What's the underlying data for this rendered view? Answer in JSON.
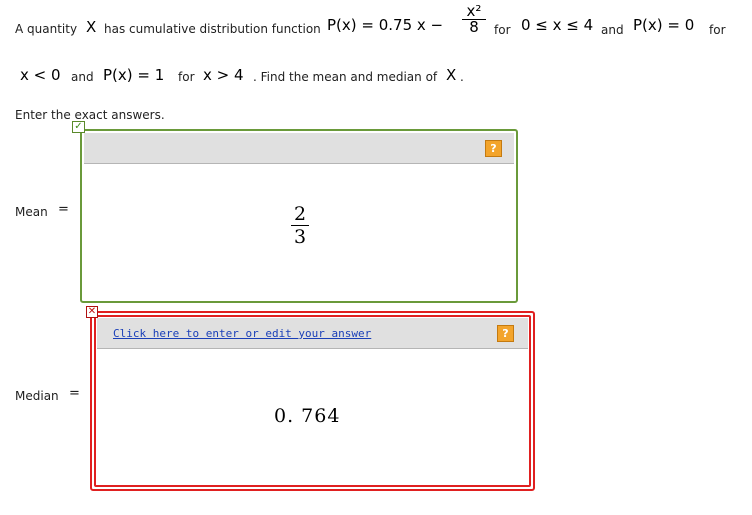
{
  "question": {
    "line1": {
      "t1": "A quantity",
      "var_x": "X",
      "t2": "has cumulative distribution function",
      "expr_lhs": "P(x)  =  0.75 x  −",
      "frac_num": "x²",
      "frac_den": "8",
      "t3": "for",
      "range": "0 ≤ x ≤ 4",
      "t4": "and",
      "expr2": "P(x)  =  0",
      "t5": "for"
    },
    "line2": {
      "cond1": "x < 0",
      "t1": "and",
      "expr": "P(x)  =  1",
      "t2": "for",
      "cond2": "x > 4",
      "t3": ". Find the mean and median of",
      "var_x": "X",
      "period": "."
    },
    "instruction": "Enter the exact answers."
  },
  "answers": {
    "mean": {
      "label": "Mean",
      "equals": "=",
      "num": "2",
      "den": "3",
      "status_icon": "check-icon",
      "help_glyph": "?"
    },
    "median": {
      "label": "Median",
      "equals": "=",
      "value": "0. 764",
      "edit_link": "Click here to enter or edit your answer",
      "status_icon": "x-icon",
      "help_glyph": "?"
    }
  },
  "colors": {
    "correct_border": "#6a9a3a",
    "incorrect_border": "#e02020",
    "help_icon": "#f3a42b",
    "link": "#1a3fb8"
  }
}
